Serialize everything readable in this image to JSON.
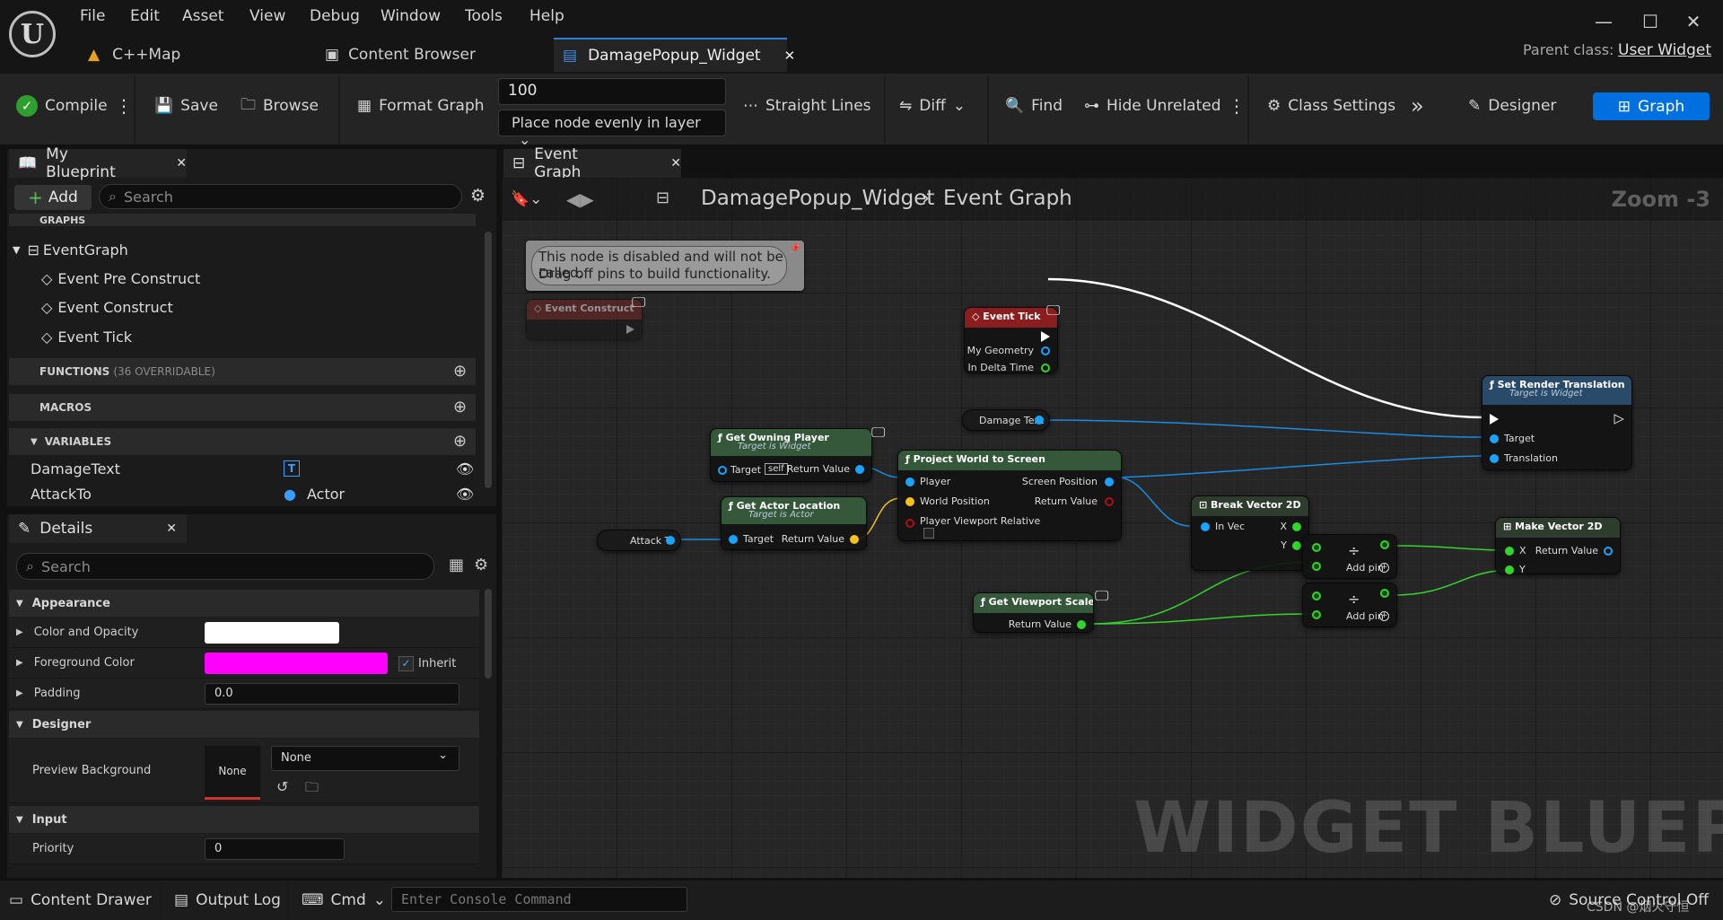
{
  "menu": [
    "File",
    "Edit",
    "Asset",
    "View",
    "Debug",
    "Window",
    "Tools",
    "Help"
  ],
  "doc_tabs": [
    "C++Map",
    "Content Browser",
    "DamagePopup_Widget"
  ],
  "parent_class": {
    "label": "Parent class:",
    "value": "User Widget"
  },
  "toolbar": {
    "compile": "Compile",
    "save": "Save",
    "browse": "Browse",
    "format_graph": "Format Graph",
    "spacing_value": "100",
    "layout_mode": "Place node evenly in layer",
    "straight_lines": "Straight Lines",
    "diff": "Diff",
    "find": "Find",
    "hide_unrelated": "Hide Unrelated",
    "class_settings": "Class Settings",
    "designer": "Designer",
    "graph": "Graph"
  },
  "my_blueprint": {
    "tab": "My Blueprint",
    "add": "Add",
    "search_placeholder": "Search",
    "graphs_header": "GRAPHS",
    "event_graph": "EventGraph",
    "events": [
      "Event Pre Construct",
      "Event Construct",
      "Event Tick"
    ],
    "functions_header": "FUNCTIONS",
    "functions_count": "(36 OVERRIDABLE)",
    "macros_header": "MACROS",
    "variables_header": "VARIABLES",
    "variables": [
      {
        "name": "DamageText",
        "type": ""
      },
      {
        "name": "AttackTo",
        "type": "Actor"
      }
    ]
  },
  "details": {
    "tab": "Details",
    "search_placeholder": "Search",
    "appearance": "Appearance",
    "color_opacity": "Color and Opacity",
    "foreground_color": "Foreground Color",
    "inherit": "Inherit",
    "padding": "Padding",
    "padding_value": "0.0",
    "designer": "Designer",
    "preview_background": "Preview Background",
    "preview_none": "None",
    "preview_select": "None",
    "input": "Input",
    "priority": "Priority",
    "priority_value": "0",
    "fg_color": "#ff00ff",
    "color_white": "#ffffff"
  },
  "graph": {
    "tab": "Event Graph",
    "breadcrumb_root": "DamagePopup_Widget",
    "breadcrumb_leaf": "Event Graph",
    "zoom": "Zoom -3",
    "watermark": "WIDGET BLUEPRINT",
    "disabled_comment": [
      "This node is disabled and will not be called.",
      "Drag off pins to build functionality."
    ],
    "nodes": {
      "event_construct": "Event Construct",
      "event_tick": {
        "title": "Event Tick",
        "pins": [
          "My Geometry",
          "In Delta Time"
        ]
      },
      "damage_text": "Damage Text",
      "get_owning_player": {
        "title": "Get Owning Player",
        "sub": "Target is Widget",
        "target": "Target",
        "self": "self",
        "ret": "Return Value"
      },
      "project_world": {
        "title": "Project World to Screen",
        "pins": [
          "Player",
          "World Position",
          "Player Viewport Relative"
        ],
        "out": [
          "Screen Position",
          "Return Value"
        ]
      },
      "attack_to": "Attack To",
      "get_actor_location": {
        "title": "Get Actor Location",
        "sub": "Target is Actor",
        "target": "Target",
        "ret": "Return Value"
      },
      "break_vector": {
        "title": "Break Vector 2D",
        "in": "In Vec",
        "x": "X",
        "y": "Y"
      },
      "divide1": {
        "add_pin": "Add pin"
      },
      "divide2": {
        "add_pin": "Add pin"
      },
      "get_viewport_scale": {
        "title": "Get Viewport Scale",
        "ret": "Return Value"
      },
      "set_render_translation": {
        "title": "Set Render Translation",
        "sub": "Target is Widget",
        "pins": [
          "Target",
          "Translation"
        ]
      },
      "make_vector": {
        "title": "Make Vector 2D",
        "x": "X",
        "y": "Y",
        "ret": "Return Value"
      }
    }
  },
  "bottom": {
    "content_drawer": "Content Drawer",
    "output_log": "Output Log",
    "cmd": "Cmd",
    "console_placeholder": "Enter Console Command",
    "source_control": "Source Control Off",
    "credit": "CSDN @烟火守恒"
  },
  "colors": {
    "accent": "#0070e0",
    "exec_white": "#ffffff",
    "object_blue": "#1aa3ff",
    "vector_yellow": "#f4c21b",
    "float_green": "#35d32e"
  }
}
